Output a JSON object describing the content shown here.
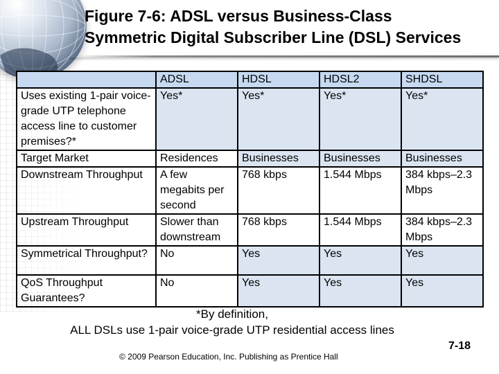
{
  "slide": {
    "title_line1": "Figure 7-6: ADSL versus Business-Class",
    "title_line2": "Symmetric Digital Subscriber Line (DSL) Services",
    "decor_icon": "globe-icon",
    "slide_number": "7-18",
    "copyright": "© 2009 Pearson Education, Inc.  Publishing as Prentice Hall",
    "colors": {
      "header_fill": "#c6d9f1",
      "cell_fill": "#dbe5f1",
      "border": "#000000"
    }
  },
  "table": {
    "columns": [
      "",
      "ADSL",
      "HDSL",
      "HDSL2",
      "SHDSL"
    ],
    "rows": [
      {
        "label": "Uses existing 1-pair voice-grade UTP telephone access line to customer premises?*",
        "values": [
          "Yes*",
          "Yes*",
          "Yes*",
          "Yes*"
        ]
      },
      {
        "label": "Target Market",
        "values": [
          "Residences",
          "Businesses",
          "Businesses",
          "Businesses"
        ]
      },
      {
        "label": "Downstream Throughput",
        "values": [
          "A few megabits per second",
          "768 kbps",
          "1.544 Mbps",
          "384 kbps–2.3 Mbps"
        ]
      },
      {
        "label": "Upstream Throughput",
        "values": [
          "Slower than downstream",
          "768 kbps",
          "1.544 Mbps",
          "384 kbps–2.3 Mbps"
        ]
      },
      {
        "label": "Symmetrical Throughput?",
        "values": [
          "No",
          "Yes",
          "Yes",
          "Yes"
        ]
      },
      {
        "label": "QoS Throughput Guarantees?",
        "values": [
          "No",
          "Yes",
          "Yes",
          "Yes"
        ]
      }
    ]
  },
  "footnote": {
    "line1": "*By definition,",
    "line2": "ALL DSLs use 1-pair voice-grade UTP residential access lines"
  }
}
